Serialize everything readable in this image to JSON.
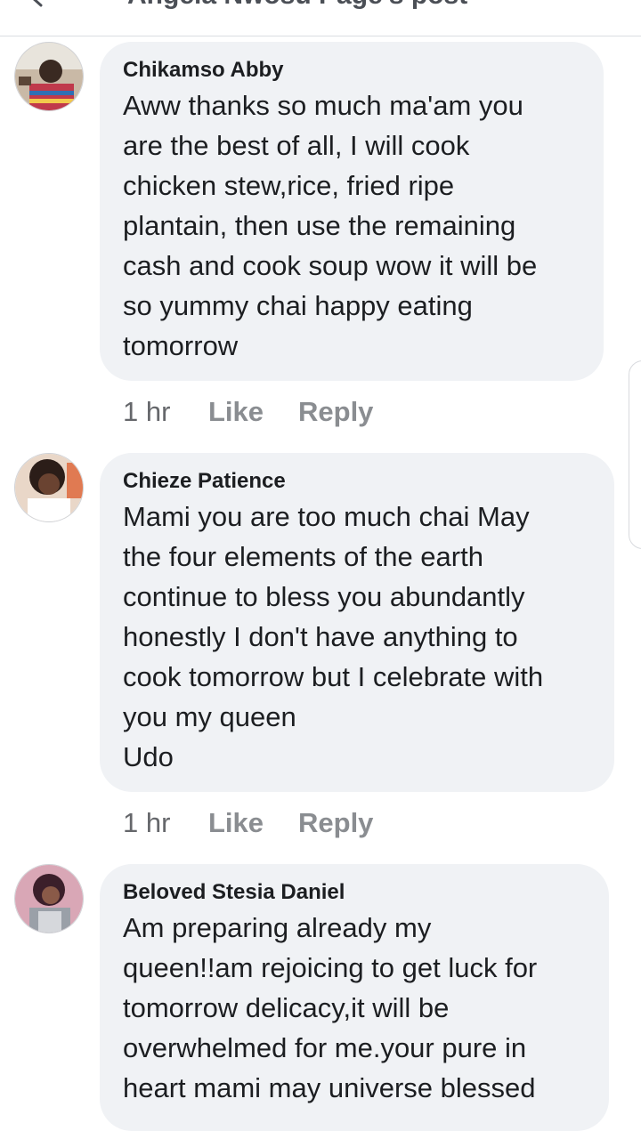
{
  "header": {
    "title": "Angela Nwosu Page's post"
  },
  "comments": [
    {
      "author": "Chikamso Abby",
      "text": "Aww thanks so much ma'am you\nare the best of all, I will cook\nchicken stew,rice, fried ripe\nplantain, then use the remaining\ncash and cook soup wow it will be\nso yummy chai happy eating\ntomorrow",
      "time": "1 hr",
      "like_label": "Like",
      "reply_label": "Reply",
      "avatar_icon": "profile-photo"
    },
    {
      "author": "Chieze Patience",
      "text": "Mami you are too much chai May\nthe four elements of the earth\ncontinue to bless you abundantly\nhonestly I don't have anything to\ncook tomorrow but I celebrate with\nyou my queen\nUdo",
      "time": "1 hr",
      "like_label": "Like",
      "reply_label": "Reply",
      "avatar_icon": "profile-photo"
    },
    {
      "author": "Beloved Stesia Daniel",
      "text": "Am preparing already my\nqueen!!am rejoicing to get luck for\ntomorrow delicacy,it will be\noverwhelmed for me.your pure in\nheart mami may universe blessed",
      "avatar_icon": "profile-photo"
    }
  ],
  "colors": {
    "bubble": "#f0f2f5",
    "text": "#1c1e21",
    "action": "#65676b"
  }
}
